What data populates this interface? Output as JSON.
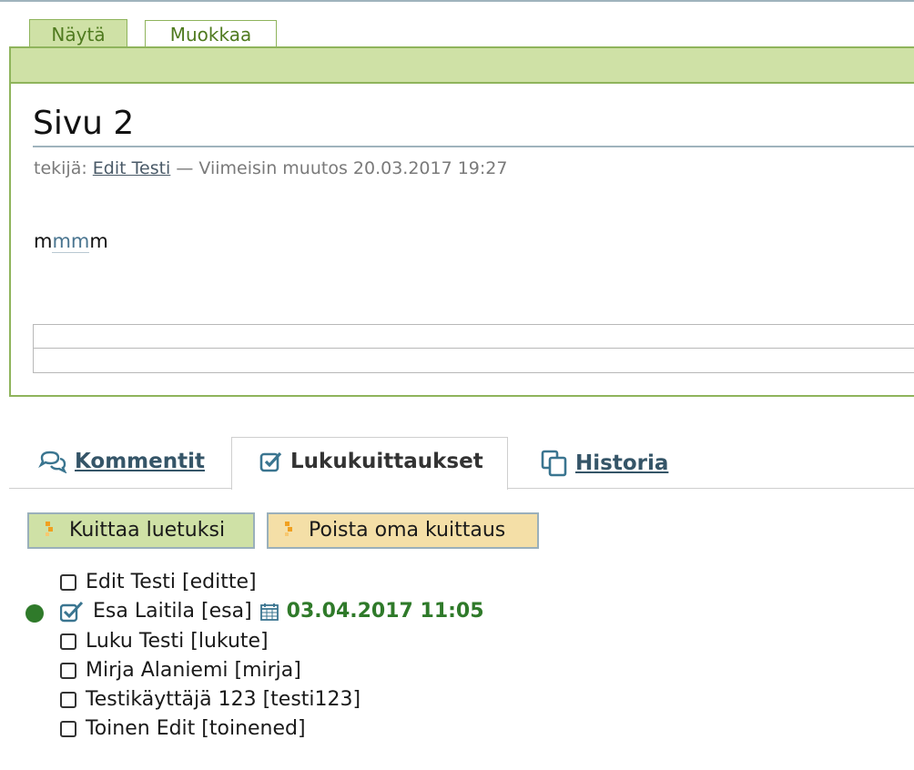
{
  "view_tabs": {
    "show": "Näytä",
    "edit": "Muokkaa"
  },
  "page": {
    "title": "Sivu 2",
    "byline_prefix": "tekijä:",
    "author": "Edit Testi",
    "byline_suffix": "— Viimeisin muutos 20.03.2017 19:27",
    "body_start": "m",
    "body_mark": "mm",
    "body_end": "m"
  },
  "tabs": {
    "comments": "Kommentit",
    "receipts": "Lukukuittaukset",
    "history": "Historia"
  },
  "buttons": {
    "ack": "Kuittaa luetuksi",
    "remove_ack": "Poista oma kuittaus"
  },
  "readers": [
    {
      "name": "Edit Testi [editte]",
      "checked": false
    },
    {
      "name": "Esa Laitila [esa]",
      "checked": true,
      "timestamp": "03.04.2017 11:05"
    },
    {
      "name": "Luku Testi [lukute]",
      "checked": false
    },
    {
      "name": "Mirja Alaniemi [mirja]",
      "checked": false
    },
    {
      "name": "Testikäyttäjä 123 [testi123]",
      "checked": false
    },
    {
      "name": "Toinen Edit [toinened]",
      "checked": false
    }
  ],
  "icons": {
    "comments": "comments-icon",
    "receipts": "check-square-icon",
    "history": "copy-icon",
    "calendar": "calendar-icon",
    "tag": "tag-icon"
  },
  "colors": {
    "green_accent": "#cfe1a6",
    "green_border": "#8fb45c",
    "yellow_button": "#f4dfa7",
    "read_green": "#2f7a2a",
    "link": "#355568"
  }
}
